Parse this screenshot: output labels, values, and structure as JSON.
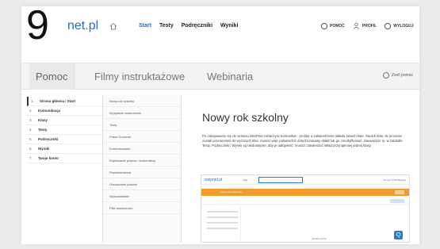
{
  "header": {
    "logo_number": "9",
    "logo_text": "net.pl",
    "nav": [
      "Start",
      "Testy",
      "Podręczniki",
      "Wyniki"
    ],
    "right": [
      "POMOC",
      "PROFIL",
      "WYLOGUJ"
    ]
  },
  "tabs": {
    "items": [
      "Pomoc",
      "Filmy instruktażowe",
      "Webinaria"
    ],
    "collapse_label": "Zwiń pomoc"
  },
  "sidebar": [
    {
      "num": "1.",
      "label": "Strona główna / Start"
    },
    {
      "num": "2.",
      "label": "Komunikacja"
    },
    {
      "num": "3.",
      "label": "Klasy"
    },
    {
      "num": "4.",
      "label": "Testy"
    },
    {
      "num": "5.",
      "label": "Podręczniki"
    },
    {
      "num": "6.",
      "label": "Wyniki"
    },
    {
      "num": "7.",
      "label": "Twoje konto"
    }
  ],
  "submenu": [
    "Nowy rok szkolny",
    "Wysyłanie wiadomości",
    "Testy",
    "Prace Domowe",
    "Komentowanie",
    "Edytowanie postów i komentarzy",
    "Powiadomienia",
    "Oznaczanie postów",
    "Wyszukiwanie",
    "Pliki wiadomości"
  ],
  "content": {
    "title": "Nowy rok szkolny",
    "paragraph": "Po zalogowaniu się do serwisu WSiPnet zobaczysz komunikat - prośbę o zatwierdzenie składu swoich klas. Twoich klas. W procesie zostali przeniesieni do wyższych klas, musisz więc potwierdzić dotychczasowy skład lub go zmodyfikować. Zauważysz to, w zakładki Testy, Podręczniki i Wyniki są niedostępne, aby je uaktywnić, musisz zatwierdzić skład przynajmniej jednej klasy."
  },
  "preview": {
    "logo": "wsipnet.pl",
    "nav": "Start",
    "right": "Pomoc  Profil  Wyloguj",
    "banner": "Zatwierdź skład klas",
    "green": "Dodaj ucznia",
    "fab": "Q"
  }
}
